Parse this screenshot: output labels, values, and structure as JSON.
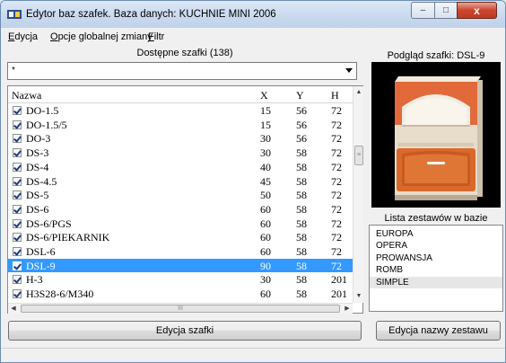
{
  "window": {
    "title": "Edytor baz szafek. Baza danych: KUCHNIE MINI 2006",
    "min_glyph": "–",
    "max_glyph": "□",
    "close_glyph": "x"
  },
  "menu": [
    {
      "underlined": "E",
      "rest": "dycja"
    },
    {
      "underlined": "O",
      "rest": "pcje globalnej zmiany"
    },
    {
      "underlined": "F",
      "rest": "iltr"
    }
  ],
  "left": {
    "header": "Dostępne szafki (138)",
    "filter_value": "*",
    "columns": [
      "Nazwa",
      "X",
      "Y",
      "H"
    ],
    "rows": [
      {
        "name": "DO-1.5",
        "x": "15",
        "y": "56",
        "h": "72",
        "checked": true,
        "selected": false
      },
      {
        "name": "DO-1.5/5",
        "x": "15",
        "y": "56",
        "h": "72",
        "checked": true,
        "selected": false
      },
      {
        "name": "DO-3",
        "x": "30",
        "y": "56",
        "h": "72",
        "checked": true,
        "selected": false
      },
      {
        "name": "DS-3",
        "x": "30",
        "y": "58",
        "h": "72",
        "checked": true,
        "selected": false
      },
      {
        "name": "DS-4",
        "x": "40",
        "y": "58",
        "h": "72",
        "checked": true,
        "selected": false
      },
      {
        "name": "DS-4.5",
        "x": "45",
        "y": "58",
        "h": "72",
        "checked": true,
        "selected": false
      },
      {
        "name": "DS-5",
        "x": "50",
        "y": "58",
        "h": "72",
        "checked": true,
        "selected": false
      },
      {
        "name": "DS-6",
        "x": "60",
        "y": "58",
        "h": "72",
        "checked": true,
        "selected": false
      },
      {
        "name": "DS-6/PGS",
        "x": "60",
        "y": "58",
        "h": "72",
        "checked": true,
        "selected": false
      },
      {
        "name": "DS-6/PIEKARNIK",
        "x": "60",
        "y": "58",
        "h": "72",
        "checked": true,
        "selected": false
      },
      {
        "name": "DSL-6",
        "x": "60",
        "y": "58",
        "h": "72",
        "checked": true,
        "selected": false
      },
      {
        "name": "DSL-9",
        "x": "90",
        "y": "58",
        "h": "72",
        "checked": true,
        "selected": true
      },
      {
        "name": "H-3",
        "x": "30",
        "y": "58",
        "h": "201",
        "checked": true,
        "selected": false
      },
      {
        "name": "H3S28-6/M340",
        "x": "60",
        "y": "58",
        "h": "201",
        "checked": true,
        "selected": false
      }
    ],
    "edit_button": "Edycja szafki",
    "scroll_up": "▲",
    "scroll_down": "▼",
    "scroll_left": "◀",
    "scroll_right": "▶",
    "vthumb_grip": "≡",
    "hthumb_grip": "III"
  },
  "right": {
    "preview_title": "Podgląd szafki: DSL-9",
    "sets_title": "Lista zestawów w bazie",
    "sets": [
      {
        "label": "EUROPA",
        "selected": false
      },
      {
        "label": "OPERA",
        "selected": false
      },
      {
        "label": "PROWANSJA",
        "selected": false
      },
      {
        "label": "ROMB",
        "selected": false
      },
      {
        "label": "SIMPLE",
        "selected": true
      }
    ],
    "edit_set_button": "Edycja nazwy zestawu"
  },
  "colors": {
    "selection": "#3399ff",
    "cabinet_front": "#d9692a",
    "cabinet_body": "#e8dccb"
  }
}
